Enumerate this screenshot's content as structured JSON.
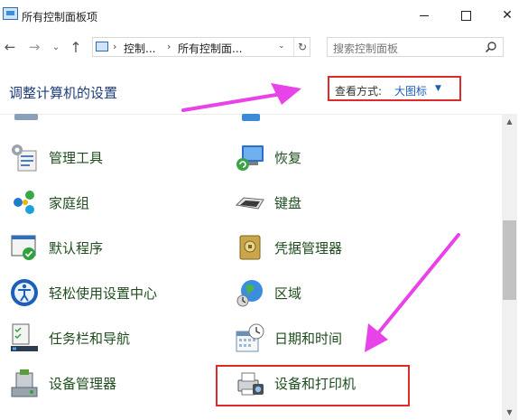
{
  "window": {
    "title": "所有控制面板项",
    "min_glyph": "",
    "close_glyph": "✕"
  },
  "nav": {
    "back_glyph": "←",
    "forward_glyph": "→",
    "recent_glyph": "⌄",
    "up_glyph": "↑"
  },
  "address": {
    "breadcrumb": [
      "控制...",
      "所有控制面..."
    ],
    "separator": "›",
    "dropdown_glyph": "⌄",
    "refresh_glyph": "↻"
  },
  "search": {
    "placeholder": "搜索控制面板"
  },
  "header": {
    "title": "调整计算机的设置",
    "view_by_label": "查看方式:",
    "view_by_value": "大图标",
    "view_by_caret": "▼"
  },
  "items": [
    {
      "label": "管理工具",
      "icon": "admin-tools-icon"
    },
    {
      "label": "恢复",
      "icon": "recovery-icon"
    },
    {
      "label": "家庭组",
      "icon": "homegroup-icon"
    },
    {
      "label": "键盘",
      "icon": "keyboard-icon"
    },
    {
      "label": "默认程序",
      "icon": "default-programs-icon"
    },
    {
      "label": "凭据管理器",
      "icon": "credential-manager-icon"
    },
    {
      "label": "轻松使用设置中心",
      "icon": "ease-of-access-icon"
    },
    {
      "label": "区域",
      "icon": "region-icon"
    },
    {
      "label": "任务栏和导航",
      "icon": "taskbar-icon"
    },
    {
      "label": "日期和时间",
      "icon": "date-time-icon"
    },
    {
      "label": "设备管理器",
      "icon": "device-manager-icon"
    },
    {
      "label": "设备和打印机",
      "icon": "devices-printers-icon"
    }
  ],
  "scrollbar": {
    "up_glyph": "▲",
    "down_glyph": "▼"
  },
  "colors": {
    "annotation_arrow": "#e843e8",
    "highlight_box": "#e02a2a",
    "link_blue": "#1a5fb4",
    "title_blue": "#1e3c78"
  }
}
